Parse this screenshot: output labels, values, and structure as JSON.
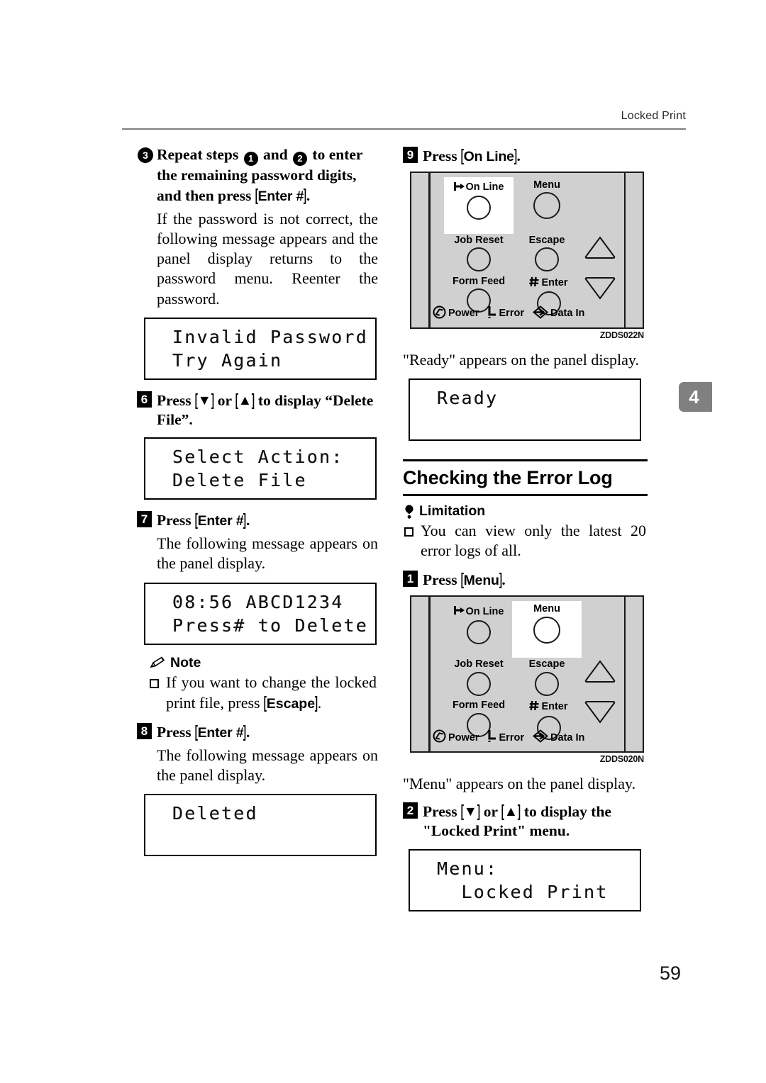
{
  "header": {
    "running_title": "Locked Print",
    "chapter_tab": "4",
    "page_number": "59"
  },
  "left_column": {
    "step3": {
      "marker": "3",
      "head_parts": {
        "a": "Repeat steps",
        "sub1": "1",
        "b": "and",
        "sub2": "2",
        "c": "to enter the remaining password digits, and then press",
        "key": "Enter #",
        "period": "."
      },
      "body": "If the password is not correct, the following message appears and the panel display returns to the password menu. Reenter the password."
    },
    "lcd_invalid": {
      "line1": "Invalid Password",
      "line2": "Try Again"
    },
    "step6": {
      "marker": "6",
      "head_a": "Press",
      "key_down": "▼",
      "head_or": "or",
      "key_up": "▲",
      "head_b": "to display “Delete File”."
    },
    "lcd_select_action": {
      "line1": "Select Action:",
      "line2": "Delete File"
    },
    "step7": {
      "marker": "7",
      "head_a": "Press",
      "key": "Enter #",
      "head_b": ".",
      "body": "The following message appears on the panel display."
    },
    "lcd_file": {
      "line1": "08:56 ABCD1234",
      "line2": "Press# to Delete"
    },
    "note": {
      "icon": "pencil-icon",
      "label": "Note",
      "bullet_a": "If you want to change the locked print file, press",
      "bullet_key": "Escape",
      "bullet_b": "."
    },
    "step8": {
      "marker": "8",
      "head_a": "Press",
      "key": "Enter #",
      "head_b": ".",
      "body": "The following message appears on the panel display."
    },
    "lcd_deleted": {
      "line1": "Deleted",
      "line2": ""
    }
  },
  "right_column": {
    "step9": {
      "marker": "9",
      "head_a": "Press",
      "key": "On Line",
      "head_b": "."
    },
    "panel_online": {
      "code": "ZDDS022N",
      "highlight": "On Line",
      "buttons": [
        {
          "label": "On Line",
          "icon": "online-arrow-icon"
        },
        {
          "label": "Menu",
          "icon": ""
        },
        {
          "label": "Job Reset",
          "icon": ""
        },
        {
          "label": "Escape",
          "icon": ""
        },
        {
          "label": "Form Feed",
          "icon": ""
        },
        {
          "label": "Enter",
          "icon": "hash-icon"
        }
      ],
      "arrows": [
        "up-triangle-icon",
        "down-triangle-icon"
      ],
      "indicators": [
        {
          "label": "Power",
          "icon": "power-icon"
        },
        {
          "label": "Error",
          "icon": "error-icon"
        },
        {
          "label": "Data In",
          "icon": "data-in-icon"
        }
      ]
    },
    "ready_text": "\"Ready\" appears on the panel display.",
    "lcd_ready": {
      "line1": "Ready",
      "line2": ""
    },
    "section": {
      "title": "Checking the Error Log"
    },
    "limitation": {
      "icon": "limitation-icon",
      "label": "Limitation",
      "bullet": "You can view only the latest 20 error logs of all."
    },
    "step1": {
      "marker": "1",
      "head_a": "Press",
      "key": "Menu",
      "head_b": "."
    },
    "panel_menu": {
      "code": "ZDDS020N",
      "highlight": "Menu",
      "buttons": [
        {
          "label": "On Line",
          "icon": "online-arrow-icon"
        },
        {
          "label": "Menu",
          "icon": ""
        },
        {
          "label": "Job Reset",
          "icon": ""
        },
        {
          "label": "Escape",
          "icon": ""
        },
        {
          "label": "Form Feed",
          "icon": ""
        },
        {
          "label": "Enter",
          "icon": "hash-icon"
        }
      ],
      "arrows": [
        "up-triangle-icon",
        "down-triangle-icon"
      ],
      "indicators": [
        {
          "label": "Power",
          "icon": "power-icon"
        },
        {
          "label": "Error",
          "icon": "error-icon"
        },
        {
          "label": "Data In",
          "icon": "data-in-icon"
        }
      ]
    },
    "menu_text": "\"Menu\" appears on the panel display.",
    "step2": {
      "marker": "2",
      "head_a": "Press",
      "key_down": "▼",
      "head_or": "or",
      "key_up": "▲",
      "head_b": "to display the \"Locked Print\" menu."
    },
    "lcd_menu": {
      "line1": "Menu:",
      "line2": "  Locked Print"
    }
  }
}
